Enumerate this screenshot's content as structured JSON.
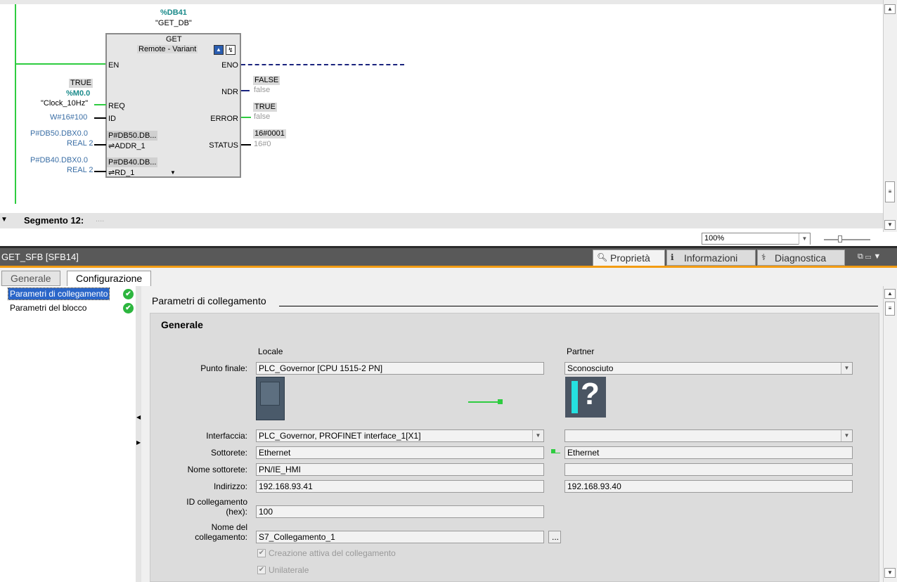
{
  "ladder": {
    "instance_addr": "%DB41",
    "instance_name": "\"GET_DB\"",
    "block_name": "GET",
    "block_variant": "Remote - Variant",
    "pins": {
      "en": "EN",
      "eno": "ENO",
      "req": "REQ",
      "id": "ID",
      "addr": "ADDR_1",
      "rd": "RD_1",
      "ndr": "NDR",
      "error": "ERROR",
      "status": "STATUS"
    },
    "inputs": {
      "req_value": "TRUE",
      "req_addr": "%M0.0",
      "req_name": "\"Clock_10Hz\"",
      "id_value": "W#16#100",
      "addr_ptr": "P#DB50.DBX0.0",
      "addr_type": "REAL 2",
      "addr_box": "P#DB50.DB...",
      "rd_ptr": "P#DB40.DBX0.0",
      "rd_type": "REAL 2",
      "rd_box": "P#DB40.DB..."
    },
    "outputs": {
      "ndr_value": "FALSE",
      "ndr_init": "false",
      "error_value": "TRUE",
      "error_init": "false",
      "status_value": "16#0001",
      "status_init": "16#0"
    },
    "segment_label": "Segmento 12:",
    "segment_comment": "....",
    "zoom": "100%"
  },
  "inspector": {
    "title": "GET_SFB [SFB14]",
    "tabs": [
      {
        "label": "Proprietà",
        "icon": "properties-icon"
      },
      {
        "label": "Informazioni",
        "icon": "info-icon"
      },
      {
        "label": "Diagnostica",
        "icon": "diagnostics-icon"
      }
    ],
    "subtabs": [
      "Generale",
      "Configurazione"
    ],
    "nav": [
      {
        "label": "Parametri di collegamento",
        "status": "ok"
      },
      {
        "label": "Parametri del blocco",
        "status": "ok"
      }
    ],
    "section_title": "Parametri di collegamento",
    "group_title": "Generale",
    "col_local": "Locale",
    "col_partner": "Partner",
    "labels": {
      "endpoint": "Punto finale:",
      "interface": "Interfaccia:",
      "subnet": "Sottorete:",
      "subnet_name": "Nome sottorete:",
      "address": "Indirizzo:",
      "conn_id_1": "ID collegamento",
      "conn_id_2": "(hex):",
      "conn_name_1": "Nome del",
      "conn_name_2": "collegamento:"
    },
    "local": {
      "endpoint": "PLC_Governor [CPU 1515-2 PN]",
      "interface": "PLC_Governor, PROFINET interface_1[X1]",
      "subnet": "Ethernet",
      "subnet_name": "PN/IE_HMI",
      "address": "192.168.93.41",
      "conn_id": "100",
      "conn_name": "S7_Collegamento_1"
    },
    "partner": {
      "endpoint": "Sconosciuto",
      "interface": "",
      "subnet": "Ethernet",
      "subnet_name": "",
      "address": "192.168.93.40"
    },
    "browse_label": "...",
    "checkbox_active": "Creazione attiva del collegamento",
    "checkbox_unilateral": "Unilaterale",
    "unknown_glyph": "?",
    "accent": "#f39c12",
    "ok_color": "#2db63f"
  }
}
